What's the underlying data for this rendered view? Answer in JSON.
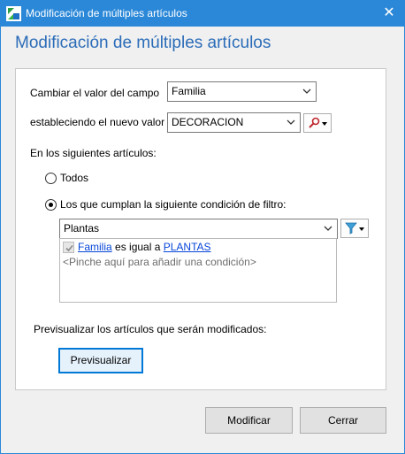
{
  "window": {
    "title": "Modificación de múltiples artículos",
    "close_glyph": "✕"
  },
  "header": {
    "title": "Modificación de múltiples artículos"
  },
  "form": {
    "field_label": "Cambiar el valor del campo",
    "field_value": "Familia",
    "new_value_label": "estableciendo el nuevo valor",
    "new_value": "DECORACION",
    "articles_label": "En los siguientes artículos:",
    "option_all": "Todos",
    "option_filter": "Los que cumplan la siguiente condición de filtro:",
    "selected_option": "filter",
    "filter_value": "Plantas",
    "condition": {
      "checked": true,
      "field": "Familia",
      "operator": "es igual a",
      "value": "PLANTAS"
    },
    "add_condition_hint": "<Pinche aquí para añadir una condición>",
    "preview_label": "Previsualizar los artículos que serán modificados:",
    "preview_button": "Previsualizar"
  },
  "footer": {
    "modify_button": "Modificar",
    "close_button": "Cerrar"
  },
  "icons": {
    "app": "app-icon",
    "search": "search-icon",
    "filter": "filter-icon"
  },
  "colors": {
    "titlebar": "#2b88d8",
    "header_text": "#2b6cb8",
    "link": "#0645d8"
  }
}
